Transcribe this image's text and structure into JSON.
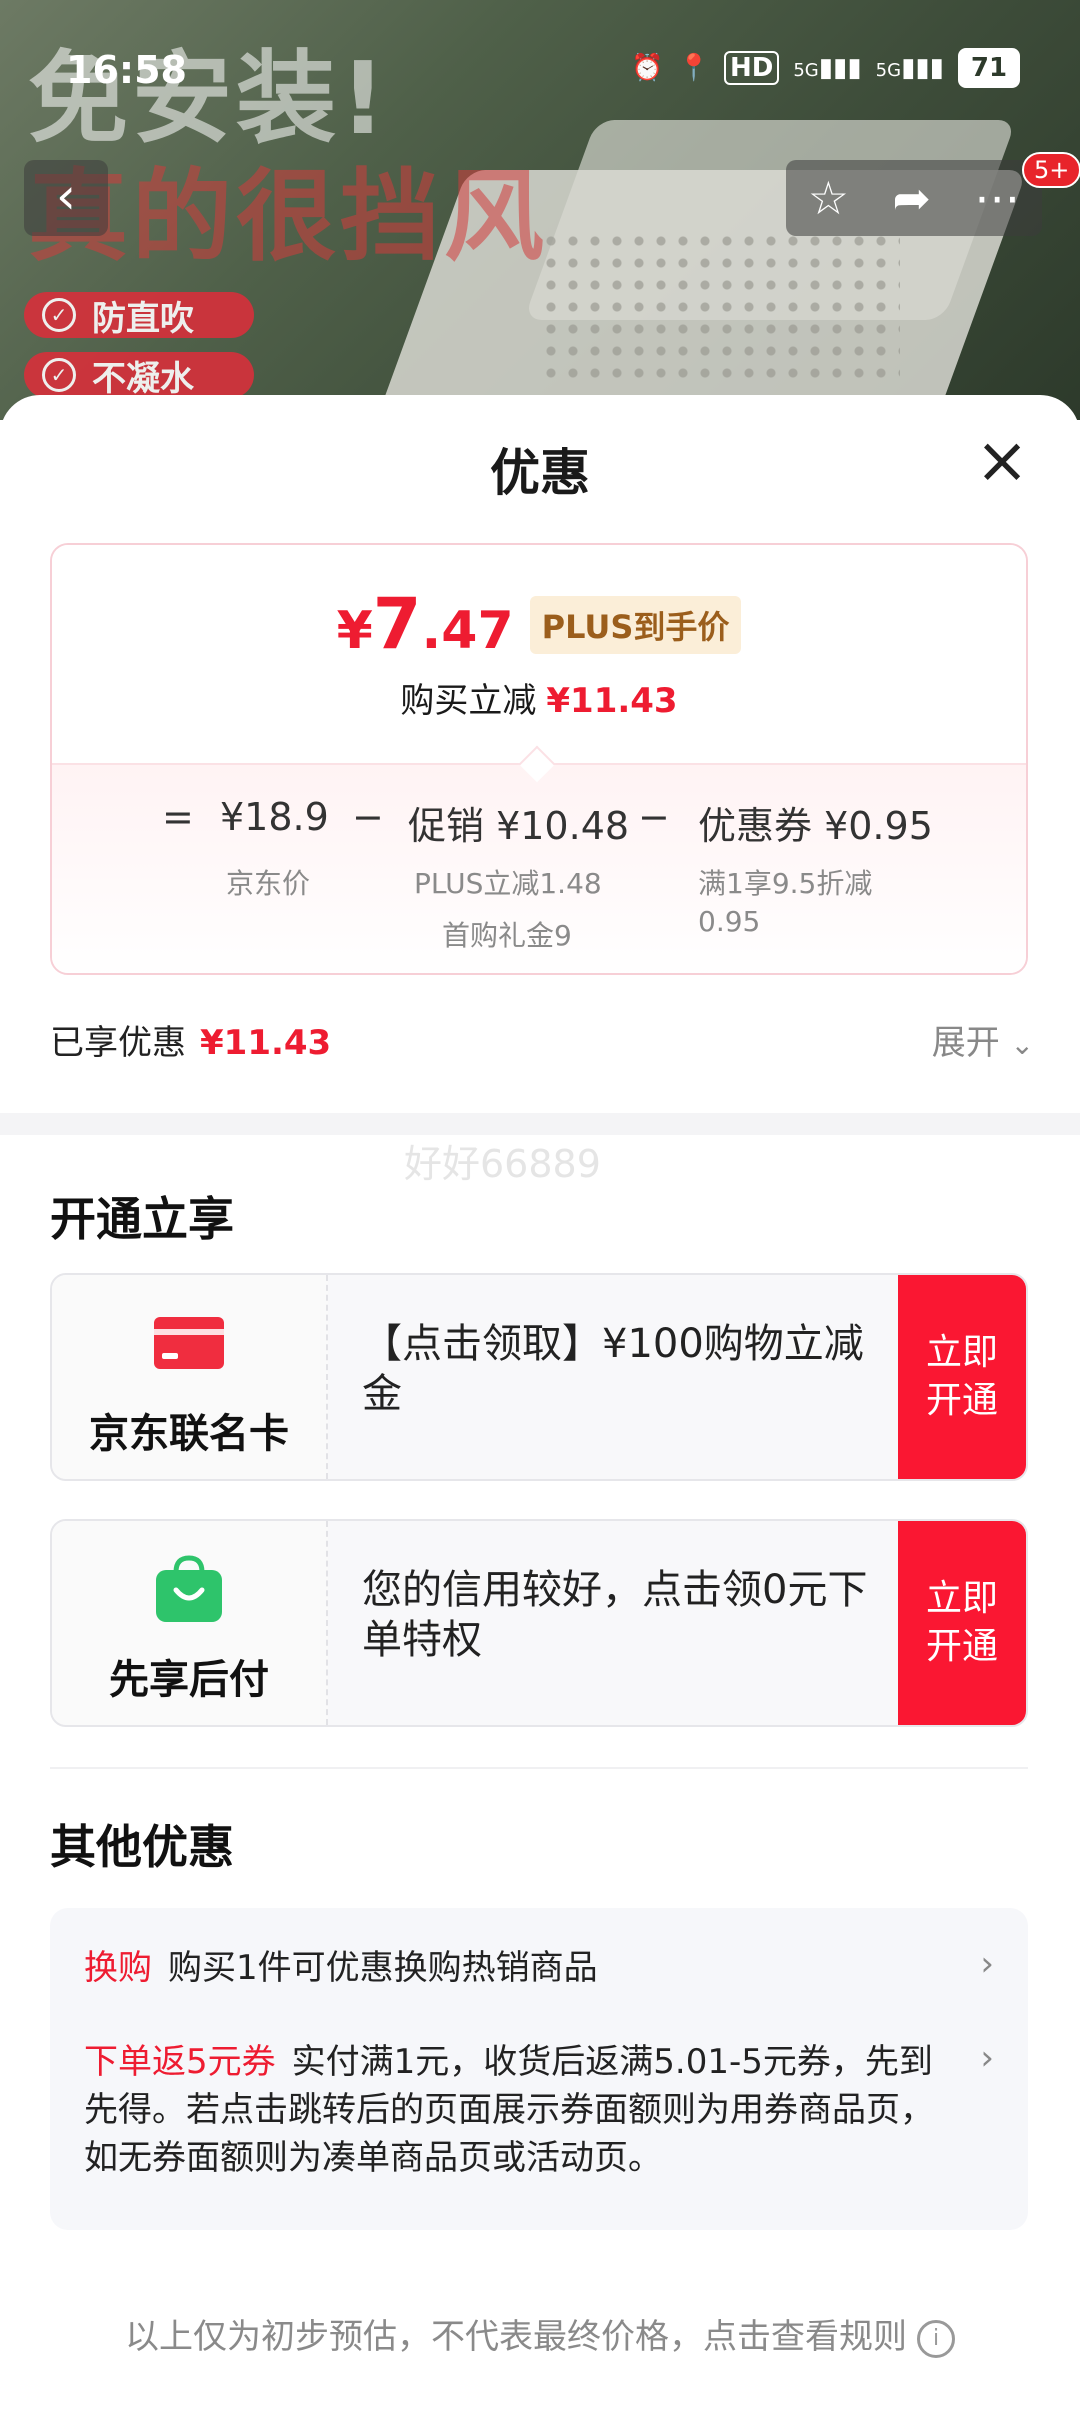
{
  "status_bar": {
    "time": "16:58",
    "battery": "71",
    "hd": "HD",
    "net1": "5G",
    "net2": "5G"
  },
  "hero": {
    "line1": "免安装!",
    "line2": "真的很挡风",
    "tags": [
      "防直吹",
      "不凝水"
    ],
    "badge": "5+"
  },
  "sheet": {
    "title": "优惠"
  },
  "price": {
    "symbol": "¥",
    "int": "7",
    "dec": ".47",
    "plus_tag": "PLUS到手价",
    "save_label": "购买立减",
    "save_value": "¥11.43"
  },
  "breakdown": {
    "eq": "=",
    "minus": "−",
    "jd_price": "¥18.9",
    "jd_label": "京东价",
    "promo": "促销 ¥10.48",
    "promo_sub1": "PLUS立减1.48",
    "promo_sub2": "首购礼金9",
    "coupon": "优惠券 ¥0.95",
    "coupon_sub1": "满1享9.5折减",
    "coupon_sub2": "0.95"
  },
  "enjoyed": {
    "label": "已享优惠",
    "value": "¥11.43",
    "expand": "展开"
  },
  "watermark": "好好66889",
  "open_section": {
    "title": "开通立享",
    "cards": [
      {
        "name": "京东联名卡",
        "desc": "【点击领取】¥100购物立减金",
        "action_l1": "立即",
        "action_l2": "开通"
      },
      {
        "name": "先享后付",
        "desc": "您的信用较好，点击领0元下单特权",
        "action_l1": "立即",
        "action_l2": "开通"
      }
    ]
  },
  "other_section": {
    "title": "其他优惠",
    "items": [
      {
        "tag": "换购",
        "text": "购买1件可优惠换购热销商品"
      },
      {
        "tag": "下单返5元券",
        "text": "实付满1元，收货后返满5.01-5元券，先到先得。若点击跳转后的页面展示券面额则为用券商品页，如无券面额则为凑单商品页或活动页。"
      }
    ]
  },
  "footer": {
    "note": "以上仅为初步预估，不代表最终价格，点击查看规则"
  },
  "colors": {
    "accent_red": "#ee1c31",
    "button_red": "#fa1732",
    "plus_gold": "#9b5e1c",
    "pay_green": "#2ec46b"
  }
}
